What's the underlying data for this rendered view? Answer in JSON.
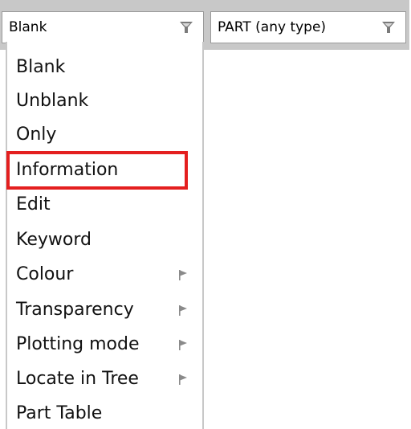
{
  "filter_bar": {
    "visibility_combo": {
      "value": "Blank",
      "icon": "filter-icon"
    },
    "type_combo": {
      "value": "PART  (any type)",
      "icon": "filter-icon"
    }
  },
  "menu": {
    "items": [
      {
        "label": "Blank",
        "has_submenu": false
      },
      {
        "label": "Unblank",
        "has_submenu": false
      },
      {
        "label": "Only",
        "has_submenu": false
      },
      {
        "label": "Information",
        "has_submenu": false
      },
      {
        "label": "Edit",
        "has_submenu": false
      },
      {
        "label": "Keyword",
        "has_submenu": false
      },
      {
        "label": "Colour",
        "has_submenu": true
      },
      {
        "label": "Transparency",
        "has_submenu": true
      },
      {
        "label": "Plotting mode",
        "has_submenu": true
      },
      {
        "label": "Locate in Tree",
        "has_submenu": true
      },
      {
        "label": "Part Table",
        "has_submenu": false
      }
    ],
    "highlighted_item": "Information"
  },
  "colors": {
    "highlight": "#e41f1f",
    "toolbar_bg": "#c8c8c8"
  }
}
